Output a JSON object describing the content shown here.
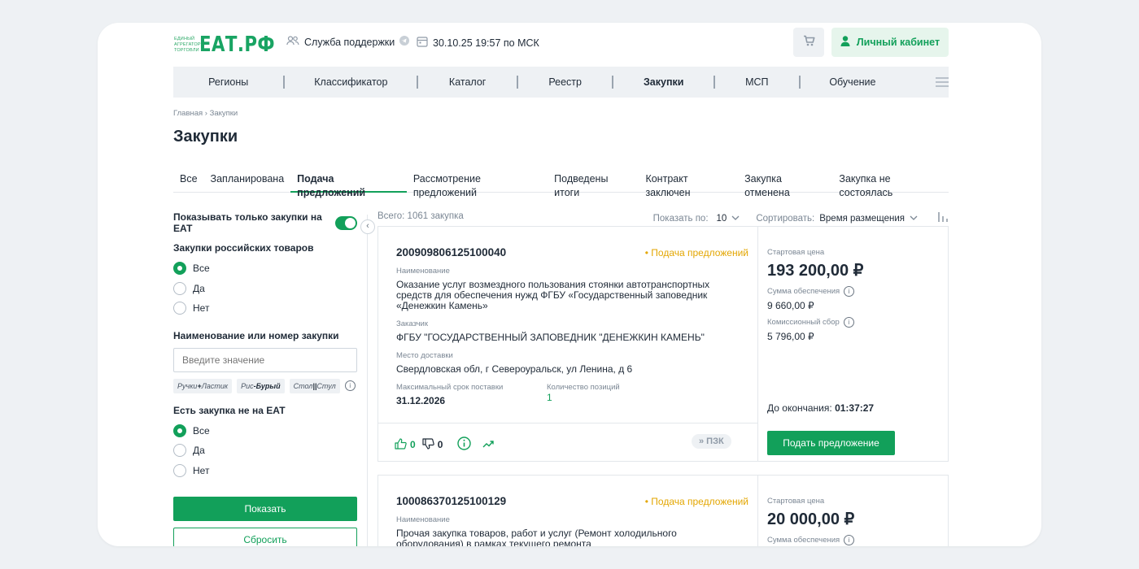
{
  "header": {
    "logo_small": "ЕДИНЫЙ АГРЕГАТОР ТОРГОВЛИ",
    "logo_big": "ЕАТ.РФ",
    "support": "Служба поддержки",
    "datetime": "30.10.25 19:57 по МСК",
    "cabinet": "Личный кабинет"
  },
  "menu": [
    "Регионы",
    "Классификатор",
    "Каталог",
    "Реестр",
    "Закупки",
    "МСП",
    "Обучение"
  ],
  "breadcrumb": "Главная › Закупки",
  "page_title": "Закупки",
  "tabs": [
    "Все",
    "Запланирована",
    "Подача предложений",
    "Рассмотрение предложений",
    "Подведены итоги",
    "Контракт заключен",
    "Закупка отменена",
    "Закупка не состоялась"
  ],
  "filters": {
    "only_eat": "Показывать только закупки на ЕАТ",
    "russian_goods": "Закупки российских товаров",
    "options": [
      "Все",
      "Да",
      "Нет"
    ],
    "name_label": "Наименование или номер закупки",
    "name_placeholder": "Введите значение",
    "chips": [
      {
        "a": "Ручки",
        "op": "+",
        "b": "Ластик"
      },
      {
        "a": "Рис",
        "op": "-",
        "b": "Бурый"
      },
      {
        "a": "Стол",
        "op": "||",
        "b": "Стул"
      }
    ],
    "not_eat": "Есть закупка не на ЕАТ",
    "show_btn": "Показать",
    "reset_btn": "Сбросить"
  },
  "results": {
    "total": "Всего: 1061 закупка",
    "show_label": "Показать по:",
    "show_value": "10",
    "sort_label": "Сортировать:",
    "sort_value": "Время размещения"
  },
  "cards": [
    {
      "number": "200909806125100040",
      "status": "• Подача предложений",
      "name_label": "Наименование",
      "name": "Оказание услуг возмездного пользования стоянки автотранспортных средств для обеспечения нужд ФГБУ «Государственный заповедник «Денежкин Камень»",
      "customer_label": "Заказчик",
      "customer": "ФГБУ \"ГОСУДАРСТВЕННЫЙ ЗАПОВЕДНИК \"ДЕНЕЖКИН КАМЕНЬ\"",
      "place_label": "Место доставки",
      "place": "Свердловская обл, г Североуральск, ул Ленина, д 6",
      "deadline_label": "Максимальный срок поставки",
      "deadline": "31.12.2026",
      "qty_label": "Количество позиций",
      "qty": "1",
      "likes": "0",
      "dislikes": "0",
      "pzk": "» ПЗК",
      "start_price_label": "Стартовая цена",
      "start_price": "193 200,00 ₽",
      "security_label": "Сумма обеспечения",
      "security": "9 660,00 ₽",
      "fee_label": "Комиссионный сбор",
      "fee": "5 796,00 ₽",
      "until_label": "До окончания:",
      "until": "01:37:27",
      "offer_btn": "Подать предложение"
    },
    {
      "number": "100086370125100129",
      "status": "• Подача предложений",
      "name_label": "Наименование",
      "name": "Прочая закупка товаров, работ и услуг (Ремонт холодильного оборудования) в рамках текущего ремонта",
      "start_price_label": "Стартовая цена",
      "start_price": "20 000,00 ₽",
      "security_label": "Сумма обеспечения"
    }
  ]
}
